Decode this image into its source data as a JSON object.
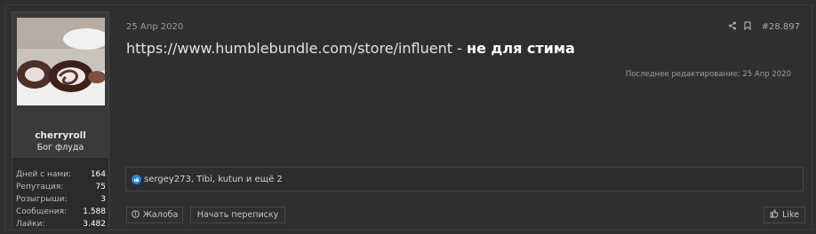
{
  "user": {
    "name": "cherryroll",
    "title": "Бог флуда",
    "stats": [
      {
        "label": "Дней с нами:",
        "value": "164"
      },
      {
        "label": "Репутация:",
        "value": "75"
      },
      {
        "label": "Розыгрыши:",
        "value": "3"
      },
      {
        "label": "Сообщения:",
        "value": "1.588"
      },
      {
        "label": "Лайки:",
        "value": "3.482"
      }
    ]
  },
  "post": {
    "date": "25 Апр 2020",
    "number": "#28.897",
    "content_link": "https://www.humblebundle.com/store/influent",
    "content_separator": " - ",
    "content_bold": "не для стима",
    "edited": "Последнее редактирование: 25 Апр 2020",
    "reactions": "sergey273, Tibi, kutun и ещё 2"
  },
  "actions": {
    "report": "Жалоба",
    "start_conversation": "Начать переписку",
    "like": "Like"
  },
  "colors": {
    "background": "#2f2f2f",
    "reaction": "#1e88e5"
  }
}
